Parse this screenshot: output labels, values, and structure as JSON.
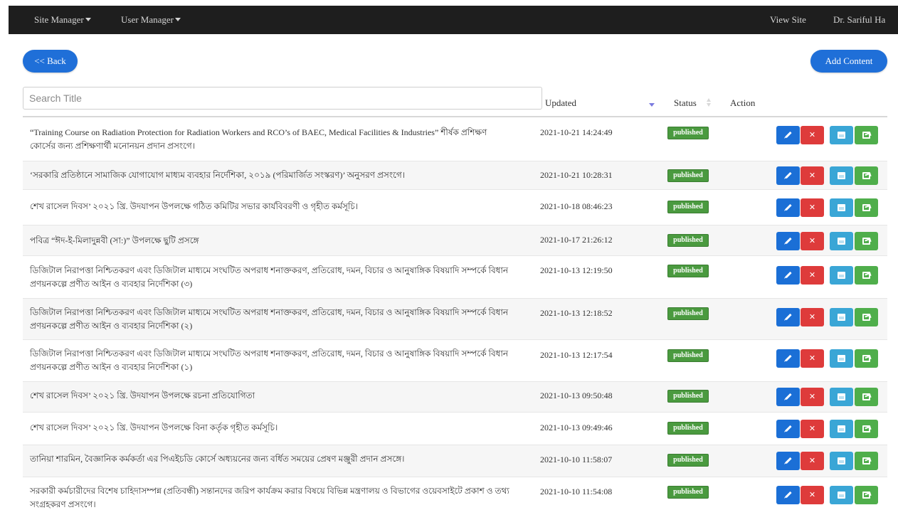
{
  "nav": {
    "site_manager": "Site Manager",
    "user_manager": "User Manager",
    "view_site": "View Site",
    "user": "Dr. Sariful Ha"
  },
  "toolbar": {
    "back_label": "<< Back",
    "add_label": "Add Content"
  },
  "search": {
    "placeholder": "Search Title"
  },
  "table": {
    "headers": {
      "updated": "Updated",
      "status": "Status",
      "action": "Action"
    },
    "rows": [
      {
        "title": "“Training Course on Radiation Protection for Radiation Workers and RCO’s of BAEC, Medical Facilities & Industries” শীর্ষক প্রশিক্ষণ কোর্সের জন্য প্রশিক্ষণার্থী মনোনয়ন প্রদান প্রসংগে।",
        "updated": "2021-10-21 14:24:49",
        "status": "published"
      },
      {
        "title": "‘সরকারি প্রতিষ্ঠানে সামাজিক যোগাযোগ মাধ্যম ব্যবহার নির্দেশিকা, ২০১৯ (পরিমার্জিত সংস্করণ)’ অনুসরণ প্রসংগে।",
        "updated": "2021-10-21 10:28:31",
        "status": "published"
      },
      {
        "title": "শেখ রাসেল দিবস’ ২০২১ খ্রি. উদযাপন উপলক্ষে গঠিত কমিটির সভার কার্যবিবরণী ও গৃহীত কর্মসূচি।",
        "updated": "2021-10-18 08:46:23",
        "status": "published"
      },
      {
        "title": "পবিত্র “ঈদ-ই-মিলাদুন্নবী (সা:)” উপলক্ষে ছুটি প্রসঙ্গে",
        "updated": "2021-10-17 21:26:12",
        "status": "published"
      },
      {
        "title": "ডিজিটাল নিরাপত্তা নিশ্চিতকরণ এবং ডিজিটাল মাধ্যমে সংঘটিত অপরাধ শনাক্তকরণ, প্রতিরোধ, দমন, বিচার ও আনুষাঙ্গিক বিষয়াদি সম্পর্কে বিধান প্রণয়নকল্পে প্রণীত আইন ও ব্যবহার নির্দেশিকা (৩)",
        "updated": "2021-10-13 12:19:50",
        "status": "published"
      },
      {
        "title": "ডিজিটাল নিরাপত্তা নিশ্চিতকরণ এবং ডিজিটাল মাধ্যমে সংঘটিত অপরাধ শনাক্তকরণ, প্রতিরোধ, দমন, বিচার ও আনুষাঙ্গিক বিষয়াদি সম্পর্কে বিধান প্রণয়নকল্পে প্রণীত আইন ও ব্যবহার নির্দেশিকা (২)",
        "updated": "2021-10-13 12:18:52",
        "status": "published"
      },
      {
        "title": "ডিজিটাল নিরাপত্তা নিশ্চিতকরণ এবং ডিজিটাল মাধ্যমে সংঘটিত অপরাধ শনাক্তকরণ, প্রতিরোধ, দমন, বিচার ও আনুষাঙ্গিক বিষয়াদি সম্পর্কে বিধান প্রণয়নকল্পে প্রণীত আইন ও ব্যবহার নির্দেশিকা (১)",
        "updated": "2021-10-13 12:17:54",
        "status": "published"
      },
      {
        "title": "শেখ রাসেল দিবস’ ২০২১ খ্রি. উদযাপন উপলক্ষে রচনা প্রতিযোগিতা",
        "updated": "2021-10-13 09:50:48",
        "status": "published"
      },
      {
        "title": "শেখ রাসেল দিবস’ ২০২১ খ্রি. উদযাপন উপলক্ষে বিনা কর্তৃক গৃহীত কর্মসূচি।",
        "updated": "2021-10-13 09:49:46",
        "status": "published"
      },
      {
        "title": "তানিয়া শারমিন, বৈজ্ঞানিক কর্মকর্তা এর পিএইচডি কোর্সে অধ্যয়নের জন্য বর্ধিত সময়ের প্রেষণ মঞ্জুরী প্রদান প্রসঙ্গে।",
        "updated": "2021-10-10 11:58:07",
        "status": "published"
      },
      {
        "title": "সরকারী কর্মচারীদের বিশেষ চাহিদাসম্পন্ন (প্রতিবন্ধী) সন্তানদের জরিপ কার্যক্রম করার বিষয়ে বিভিন্ন মন্ত্রণালয় ও বিভাগের ওয়েবসাইটে প্রকাশ ও তথ্য সংগ্রহকরণ প্রসংগে।",
        "updated": "2021-10-10 11:54:08",
        "status": "published"
      }
    ]
  },
  "colors": {
    "navbar": "#1e1e1e",
    "primary": "#1f6fd8",
    "published": "#4a9a3f",
    "delete": "#de3b3b",
    "info": "#3aa6d6",
    "success": "#4fae4b"
  }
}
